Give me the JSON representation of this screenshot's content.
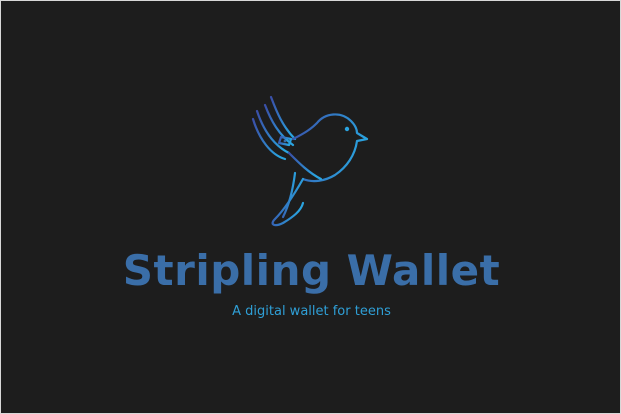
{
  "brand": {
    "name": "Stripling Wallet",
    "tagline": "A digital wallet for teens"
  },
  "logo": {
    "icon": "bird-icon",
    "gradient_start": "#3a4fa8",
    "gradient_end": "#2aa3df"
  },
  "colors": {
    "background": "#1d1d1d",
    "name_text": "#3a6ea8",
    "tagline_text": "#2f9fd6"
  }
}
